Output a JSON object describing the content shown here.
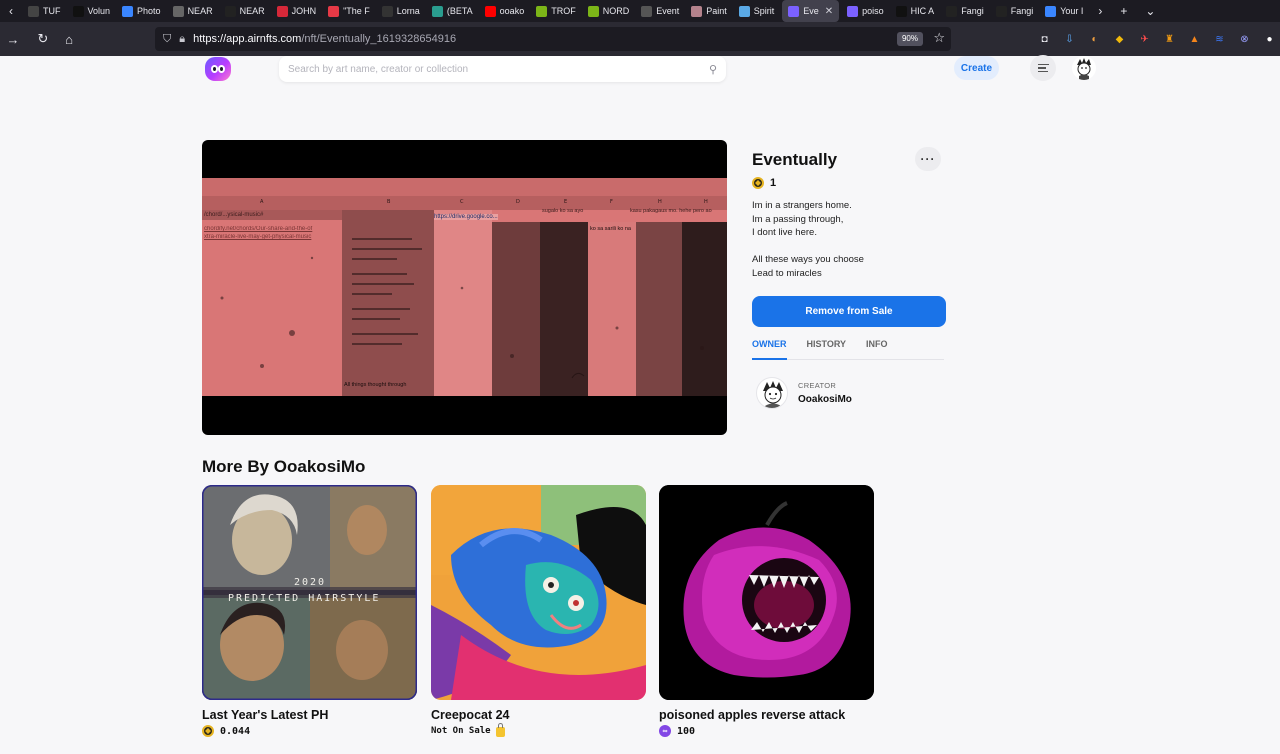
{
  "browser": {
    "tabs": [
      {
        "label": "TUF",
        "color": "#444",
        "active": false
      },
      {
        "label": "Volun",
        "color": "#111",
        "active": false
      },
      {
        "label": "Photo",
        "color": "#3a86ff",
        "active": false
      },
      {
        "label": "NEAR",
        "color": "#666",
        "active": false
      },
      {
        "label": "NEAR",
        "color": "#222",
        "active": false
      },
      {
        "label": "JOHN",
        "color": "#d62839",
        "active": false
      },
      {
        "label": "\"The F",
        "color": "#e63946",
        "active": false
      },
      {
        "label": "Lorna",
        "color": "#333",
        "active": false
      },
      {
        "label": "(BETA",
        "color": "#2a9d8f",
        "active": false
      },
      {
        "label": "ooako",
        "color": "#ff0000",
        "active": false
      },
      {
        "label": "TROF",
        "color": "#7cb518",
        "active": false
      },
      {
        "label": "NORD",
        "color": "#7cb518",
        "active": false
      },
      {
        "label": "Event",
        "color": "#555",
        "active": false
      },
      {
        "label": "Paint",
        "color": "#b5838d",
        "active": false
      },
      {
        "label": "Spirit",
        "color": "#5aa9e6",
        "active": false
      },
      {
        "label": "Eve",
        "color": "#7b61ff",
        "active": true
      },
      {
        "label": "poiso",
        "color": "#7b61ff",
        "active": false
      },
      {
        "label": "HIC A",
        "color": "#111",
        "active": false
      },
      {
        "label": "Fangi",
        "color": "#222",
        "active": false
      },
      {
        "label": "Fangi",
        "color": "#222",
        "active": false
      },
      {
        "label": "Your I",
        "color": "#3a86ff",
        "active": false
      }
    ],
    "url_host": "https://app.airnfts.com",
    "url_path": "/nft/Eventually_1619328654916",
    "zoom": "90%"
  },
  "site": {
    "search_placeholder": "Search by art name, creator or collection",
    "create_label": "Create"
  },
  "nft": {
    "title": "Eventually",
    "edition": "1",
    "description_lines": [
      "Im in a strangers home.",
      "Im a passing through,",
      "I dont live here.",
      "",
      "All these ways you choose",
      "Lead to miracles"
    ],
    "sale_button": "Remove from Sale",
    "tabs": [
      "OWNER",
      "HISTORY",
      "INFO"
    ],
    "creator_caption": "CREATOR",
    "creator_name": "OoakosiMo",
    "art_texts": {
      "chord": "/chord/...ysical-music#",
      "link": "https://drive.google.co...",
      "sugal": "sugalo ko sa ayo",
      "kasu": "kasu pakagaus mo. hehe pero ao",
      "korin": "ko sa sarili ko na",
      "line1": "chordify.net/chords/Our-share-and-the-of",
      "line2": "xtra-miracle-live-may-get-physical-music",
      "caption": "All things thought through",
      "p2022": "2020"
    }
  },
  "more": {
    "heading": "More By OoakosiMo",
    "cards": [
      {
        "title": "Last Year's Latest PH",
        "price": "0.044",
        "currency": "bnb",
        "art_line1": "2020",
        "art_line2": "PREDICTED HAIRSTYLE"
      },
      {
        "title": "Creepocat 24",
        "price": "Not On Sale",
        "currency": "lock"
      },
      {
        "title": "poisoned apples reverse attack",
        "price": "100",
        "currency": "matic"
      }
    ]
  }
}
